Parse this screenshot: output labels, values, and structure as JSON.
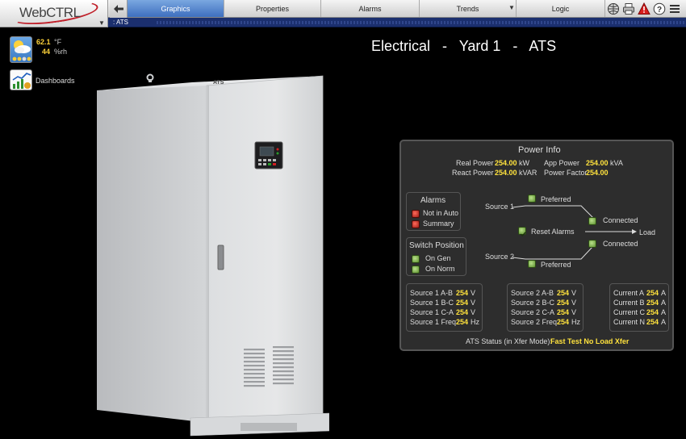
{
  "header": {
    "logo_text": "WebCTRL",
    "tabs": [
      {
        "label": "Graphics",
        "active": true
      },
      {
        "label": "Properties",
        "active": false
      },
      {
        "label": "Alarms",
        "active": false
      },
      {
        "label": "Trends",
        "active": false
      },
      {
        "label": "Logic",
        "active": false
      }
    ],
    "tool_icons": [
      "home-globe-icon",
      "print-icon",
      "alarm-warning-icon",
      "help-icon",
      "menu-icon"
    ]
  },
  "path": {
    "text": ": ATS"
  },
  "weather": {
    "temperature": "62.1",
    "temperature_unit": "°F",
    "humidity": "44",
    "humidity_unit": "%rh"
  },
  "dashboards": {
    "label": "Dashboards"
  },
  "page": {
    "title": "Electrical   -   Yard 1   -   ATS"
  },
  "cabinet": {
    "label": "ATS"
  },
  "power_info": {
    "title": "Power Info",
    "real_power_label": "Real Power",
    "real_power_value": "254.00",
    "real_power_unit": "kW",
    "react_power_label": "React Power",
    "react_power_value": "254.00",
    "react_power_unit": "kVAR",
    "app_power_label": "App Power",
    "app_power_value": "254.00",
    "app_power_unit": "kVA",
    "power_factor_label": "Power Factor",
    "power_factor_value": "254.00"
  },
  "alarms": {
    "title": "Alarms",
    "not_in_auto": "Not in Auto",
    "summary": "Summary"
  },
  "switch_position": {
    "title": "Switch Position",
    "on_gen": "On Gen",
    "on_norm": "On Norm"
  },
  "diagram": {
    "source1": "Source 1",
    "source2": "Source 2",
    "preferred1": "Preferred",
    "preferred2": "Preferred",
    "connected1": "Connected",
    "connected2": "Connected",
    "reset_alarms": "Reset Alarms",
    "load": "Load"
  },
  "source1": {
    "ab_label": "Source 1 A-B",
    "ab_value": "254",
    "ab_unit": "V",
    "bc_label": "Source 1 B-C",
    "bc_value": "254",
    "bc_unit": "V",
    "ca_label": "Source 1 C-A",
    "ca_value": "254",
    "ca_unit": "V",
    "freq_label": "Source 1 Freq",
    "freq_value": "254",
    "freq_unit": "Hz"
  },
  "source2": {
    "ab_label": "Source 2 A-B",
    "ab_value": "254",
    "ab_unit": "V",
    "bc_label": "Source 2 B-C",
    "bc_value": "254",
    "bc_unit": "V",
    "ca_label": "Source 2 C-A",
    "ca_value": "254",
    "ca_unit": "V",
    "freq_label": "Source 2 Freq",
    "freq_value": "254",
    "freq_unit": "Hz"
  },
  "currents": {
    "a_label": "Current A",
    "a_value": "254",
    "a_unit": "A",
    "b_label": "Current B",
    "b_value": "254",
    "b_unit": "A",
    "c_label": "Current C",
    "c_value": "254",
    "c_unit": "A",
    "n_label": "Current N",
    "n_value": "254",
    "n_unit": "A"
  },
  "status": {
    "label": "ATS Status (in Xfer Mode):",
    "value": "Fast Test No Load Xfer"
  },
  "colors": {
    "accent_tab": "#3e6fbf",
    "value_yellow": "#ffe23d",
    "path_bar": "#1b2f6e",
    "alarm_red": "#c0202a"
  }
}
